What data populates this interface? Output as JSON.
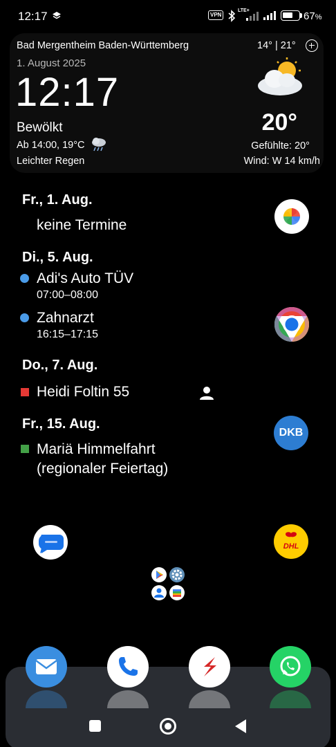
{
  "status_bar": {
    "time": "12:17",
    "vpn": "VPN",
    "lte": "LTE+",
    "battery_percent": "67",
    "battery_unit": "%",
    "battery_level": 0.67
  },
  "weather": {
    "location": "Bad Mergentheim Baden-Württemberg",
    "min_max": "14° | 21°",
    "date": "1. August 2025",
    "clock": "12:17",
    "condition": "Bewölkt",
    "forecast": "Ab 14:00, 19°C",
    "rain": "Leichter Regen",
    "temperature": "20°",
    "feels_like": "Gefühlte: 20°",
    "wind": "Wind: W 14 km/h"
  },
  "calendar": {
    "days": [
      {
        "date": "Fr., 1. Aug.",
        "events": [
          {
            "title": "keine Termine"
          }
        ]
      },
      {
        "date": "Di., 5. Aug.",
        "events": [
          {
            "title": "Adi's Auto TÜV",
            "time": "07:00–08:00",
            "color": "#4a9be8"
          },
          {
            "title": "Zahnarzt",
            "time": "16:15–17:15",
            "color": "#4a9be8"
          }
        ]
      },
      {
        "date": "Do., 7. Aug.",
        "events": [
          {
            "title": "Heidi Foltin 55",
            "color": "#e53935"
          }
        ]
      },
      {
        "date": "Fr., 15. Aug.",
        "events": [
          {
            "title": "Mariä Himmelfahrt",
            "title2": "(regionaler Feiertag)",
            "color": "#43a047"
          }
        ]
      }
    ]
  },
  "apps": {
    "dkb_label": "DKB",
    "dhl_label": "DHL"
  },
  "colors": {
    "widget_bg": "#0d0d0d",
    "dock_bg": "#2a2d33",
    "dkb": "#2d7dd2",
    "dhl": "#ffcc00",
    "whatsapp": "#25d366",
    "mail": "#3a8ee0"
  }
}
